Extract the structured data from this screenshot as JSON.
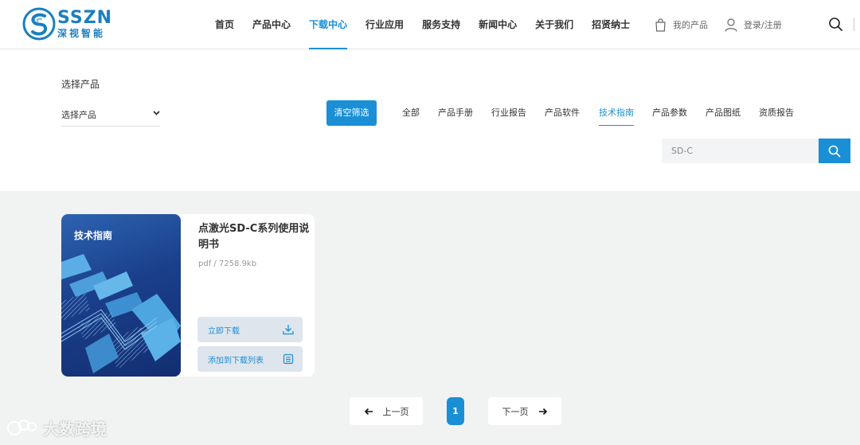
{
  "brand": {
    "name_en": "SSZN",
    "name_cn": "深视智能"
  },
  "nav": {
    "items": [
      {
        "label": "首页",
        "active": false
      },
      {
        "label": "产品中心",
        "active": false
      },
      {
        "label": "下载中心",
        "active": true
      },
      {
        "label": "行业应用",
        "active": false
      },
      {
        "label": "服务支持",
        "active": false
      },
      {
        "label": "新闻中心",
        "active": false
      },
      {
        "label": "关于我们",
        "active": false
      },
      {
        "label": "招贤纳士",
        "active": false
      }
    ],
    "my_products": "我的产品",
    "login": "登录/注册"
  },
  "filter": {
    "product_label": "选择产品",
    "product_select_value": "选择产品",
    "clear_label": "清空筛选",
    "categories": [
      {
        "label": "全部",
        "active": false
      },
      {
        "label": "产品手册",
        "active": false
      },
      {
        "label": "行业报告",
        "active": false
      },
      {
        "label": "产品软件",
        "active": false
      },
      {
        "label": "技术指南",
        "active": true
      },
      {
        "label": "产品参数",
        "active": false
      },
      {
        "label": "产品图纸",
        "active": false
      },
      {
        "label": "资质报告",
        "active": false
      }
    ],
    "search_value": "SD-C"
  },
  "results": [
    {
      "cover_label": "技术指南",
      "title": "点激光SD-C系列使用说明书",
      "meta": "pdf / 7258.9kb",
      "download_label": "立即下载",
      "add_label": "添加到下载列表"
    }
  ],
  "pagination": {
    "prev": "上一页",
    "current": "1",
    "next": "下一页"
  },
  "watermark": "大数跨境",
  "colors": {
    "accent": "#1a8fd6",
    "cover_dark": "#132e72",
    "background_gray": "#f1f2f2"
  }
}
